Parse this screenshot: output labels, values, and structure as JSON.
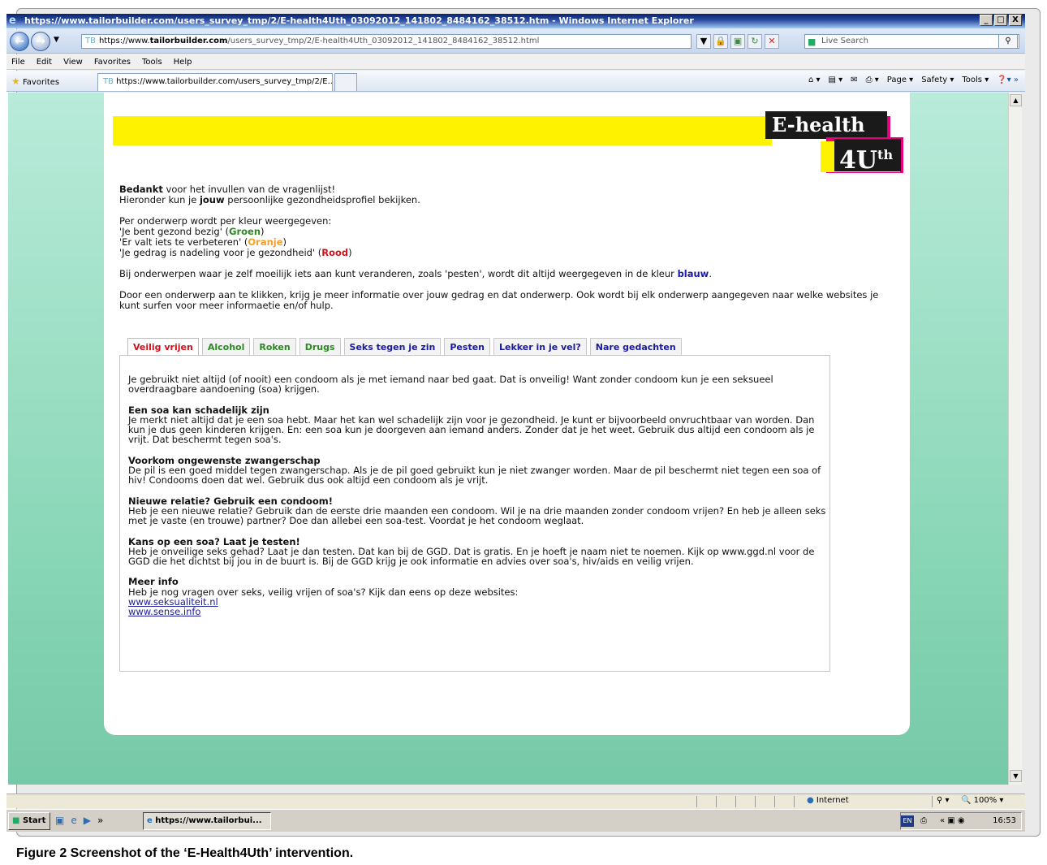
{
  "window": {
    "title": "https://www.tailorbuilder.com/users_survey_tmp/2/E-health4Uth_03092012_141802_8484162_38512.htm - Windows Internet Explorer",
    "minimize": "_",
    "maximize": "□",
    "close": "X"
  },
  "address": {
    "tb": "TB",
    "https": "https://www.",
    "domain": "tailorbuilder.com",
    "rest": "/users_survey_tmp/2/E-health4Uth_03092012_141802_8484162_38512.html"
  },
  "search": {
    "placeholder": "Live Search"
  },
  "menu": [
    "File",
    "Edit",
    "View",
    "Favorites",
    "Tools",
    "Help"
  ],
  "favorites": {
    "label": "Favorites",
    "tab_title": "https://www.tailorbuilder.com/users_survey_tmp/2/E...",
    "commands": [
      "Page ▾",
      "Safety ▾",
      "Tools ▾"
    ]
  },
  "logo": {
    "line1": "E-health",
    "line2": "4U",
    "sup": "th"
  },
  "intro": {
    "thanks_bold": "Bedankt",
    "thanks_rest": " voor het invullen van de vragenlijst!",
    "line2_a": "Hieronder kun je ",
    "line2_bold": "jouw",
    "line2_b": " persoonlijke gezondheidsprofiel bekijken.",
    "colors_intro": "Per onderwerp wordt per kleur weergegeven:",
    "green_a": "'Je bent gezond bezig' (",
    "green_word": "Groen",
    "orange_a": "'Er valt iets te verbeteren' (",
    "orange_word": "Oranje",
    "red_a": "'Je gedrag is nadeling voor je gezondheid' (",
    "red_word": "Rood",
    "close_paren": ")",
    "blue_a": "Bij onderwerpen waar je zelf moeilijk iets aan kunt veranderen, zoals 'pesten', wordt dit altijd weergegeven in de kleur ",
    "blue_word": "blauw",
    "blue_end": ".",
    "click_info": "Door een onderwerp aan te klikken, krijg je meer informatie over jouw gedrag en dat onderwerp. Ook wordt bij elk onderwerp aangegeven naar welke websites je kunt surfen voor meer informaetie en/of hulp."
  },
  "tabs": [
    "Veilig vrijen",
    "Alcohol",
    "Roken",
    "Drugs",
    "Seks tegen je zin",
    "Pesten",
    "Lekker in je vel?",
    "Nare gedachten"
  ],
  "panel": {
    "intro": "Je gebruikt niet altijd (of nooit) een condoom als je met iemand naar bed gaat. Dat is onveilig! Want zonder condoom kun je een seksueel overdraagbare aandoening (soa) krijgen.",
    "sections": [
      {
        "heading": "Een soa kan schadelijk zijn",
        "text": "Je merkt niet altijd dat je een soa hebt. Maar het kan wel schadelijk zijn voor je gezondheid. Je kunt er bijvoorbeeld onvruchtbaar van worden. Dan kun je dus geen kinderen krijgen. En: een soa kun je doorgeven aan iemand anders. Zonder dat je het weet. Gebruik dus altijd een condoom als je vrijt. Dat beschermt tegen soa's."
      },
      {
        "heading": "Voorkom ongewenste zwangerschap",
        "text": "De pil is een goed middel tegen zwangerschap. Als je de pil goed gebruikt kun je niet zwanger worden. Maar de pil beschermt niet tegen een soa of hiv! Condooms doen dat wel. Gebruik dus ook altijd een condoom als je vrijt."
      },
      {
        "heading": "Nieuwe relatie? Gebruik een condoom!",
        "text": "Heb je een nieuwe relatie? Gebruik dan de eerste drie maanden een condoom. Wil je na drie maanden zonder condoom vrijen? En heb je alleen seks met je vaste (en trouwe) partner? Doe dan allebei een soa-test. Voordat je het condoom weglaat."
      },
      {
        "heading": "Kans op een soa? Laat je testen!",
        "text": "Heb je onveilige seks gehad? Laat je dan testen. Dat kan bij de GGD. Dat is gratis. En je hoeft je naam niet te noemen. Kijk op www.ggd.nl voor de GGD die het dichtst bij jou in de buurt is. Bij de GGD krijg je ook informatie en advies over soa's, hiv/aids en veilig vrijen."
      },
      {
        "heading": "Meer info",
        "text": "Heb je nog vragen over seks, veilig vrijen of soa's? Kijk dan eens op deze websites:"
      }
    ],
    "links": [
      "www.seksualiteit.nl",
      "www.sense.info"
    ]
  },
  "status": {
    "zone": "Internet",
    "zoom": "100%"
  },
  "taskbar": {
    "start": "Start",
    "task": "https://www.tailorbui...",
    "lang": "EN",
    "clock": "16:53"
  },
  "caption": {
    "bold": "Figure 2 Screenshot of the ‘E-Health4Uth’ intervention.",
    "rest": ""
  },
  "colors": {
    "green": "#2b8a22",
    "orange": "#f0a030",
    "red": "#d0111b",
    "blue": "#1a1a9f",
    "yellow": "#fff200",
    "magenta": "#e5007e"
  }
}
